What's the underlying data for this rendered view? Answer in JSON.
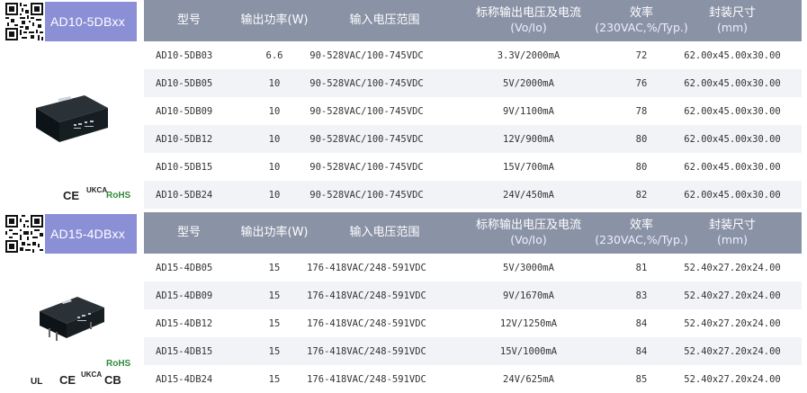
{
  "headers": {
    "model": "型号",
    "power": "输出功率(W)",
    "input": "输入电压范围",
    "output_main": "标称输出电压及电流",
    "output_sub": "(Vo/Io)",
    "eff_main": "效率",
    "eff_sub": "(230VAC,%/Typ.)",
    "size_main": "封装尺寸",
    "size_sub": "(mm)"
  },
  "series": [
    {
      "tag": "AD10-5DBxx",
      "certs": [
        "CE",
        "UKCA",
        "RoHS"
      ],
      "rows": [
        {
          "model": "AD10-5DB03",
          "power": "6.6",
          "input": "90-528VAC/100-745VDC",
          "output": "3.3V/2000mA",
          "eff": "72",
          "size": "62.00x45.00x30.00"
        },
        {
          "model": "AD10-5DB05",
          "power": "10",
          "input": "90-528VAC/100-745VDC",
          "output": "5V/2000mA",
          "eff": "76",
          "size": "62.00x45.00x30.00"
        },
        {
          "model": "AD10-5DB09",
          "power": "10",
          "input": "90-528VAC/100-745VDC",
          "output": "9V/1100mA",
          "eff": "78",
          "size": "62.00x45.00x30.00"
        },
        {
          "model": "AD10-5DB12",
          "power": "10",
          "input": "90-528VAC/100-745VDC",
          "output": "12V/900mA",
          "eff": "80",
          "size": "62.00x45.00x30.00"
        },
        {
          "model": "AD10-5DB15",
          "power": "10",
          "input": "90-528VAC/100-745VDC",
          "output": "15V/700mA",
          "eff": "80",
          "size": "62.00x45.00x30.00"
        },
        {
          "model": "AD10-5DB24",
          "power": "10",
          "input": "90-528VAC/100-745VDC",
          "output": "24V/450mA",
          "eff": "82",
          "size": "62.00x45.00x30.00"
        }
      ]
    },
    {
      "tag": "AD15-4DBxx",
      "certs": [
        "RoHS",
        "UL",
        "CE",
        "UKCA",
        "CB"
      ],
      "rows": [
        {
          "model": "AD15-4DB05",
          "power": "15",
          "input": "176-418VAC/248-591VDC",
          "output": "5V/3000mA",
          "eff": "81",
          "size": "52.40x27.20x24.00"
        },
        {
          "model": "AD15-4DB09",
          "power": "15",
          "input": "176-418VAC/248-591VDC",
          "output": "9V/1670mA",
          "eff": "83",
          "size": "52.40x27.20x24.00"
        },
        {
          "model": "AD15-4DB12",
          "power": "15",
          "input": "176-418VAC/248-591VDC",
          "output": "12V/1250mA",
          "eff": "84",
          "size": "52.40x27.20x24.00"
        },
        {
          "model": "AD15-4DB15",
          "power": "15",
          "input": "176-418VAC/248-591VDC",
          "output": "15V/1000mA",
          "eff": "84",
          "size": "52.40x27.20x24.00"
        },
        {
          "model": "AD15-4DB24",
          "power": "15",
          "input": "176-418VAC/248-591VDC",
          "output": "24V/625mA",
          "eff": "85",
          "size": "52.40x27.20x24.00"
        }
      ]
    }
  ],
  "colors": {
    "tag_bg": "#8b8fd6",
    "header_bg": "#8a92a6",
    "row_alt": "#f2f3f7",
    "rohs_green": "#2e8b3a"
  }
}
